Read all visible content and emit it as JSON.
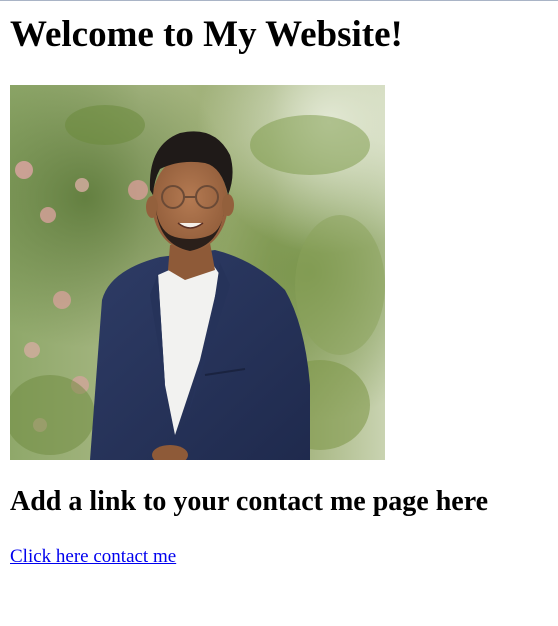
{
  "page": {
    "heading": "Welcome to My Website!",
    "subheading": "Add a link to your contact me page here",
    "link_text": "Click here contact me"
  },
  "photo": {
    "icon": "profile-photo"
  },
  "colors": {
    "link": "#0000ee",
    "text": "#000000",
    "background": "#ffffff"
  }
}
